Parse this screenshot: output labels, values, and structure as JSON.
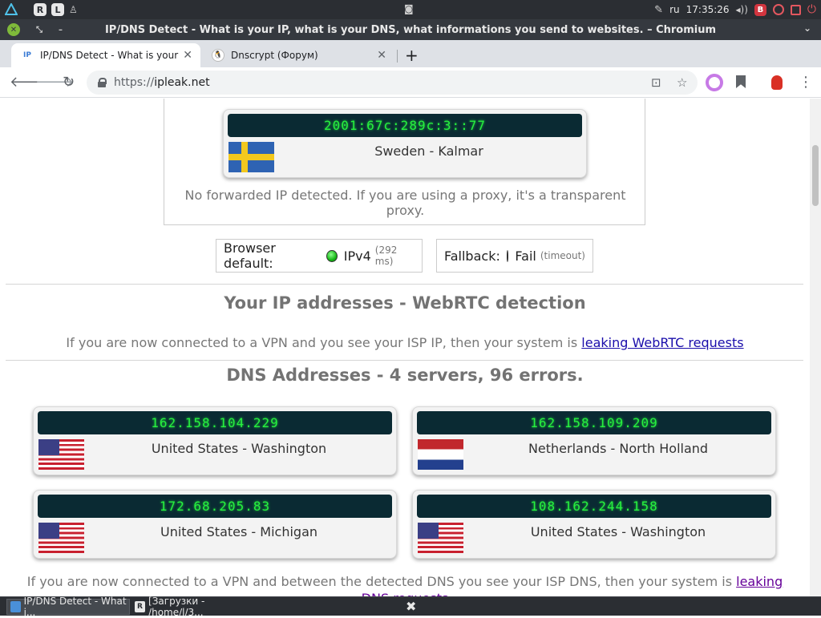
{
  "os_panel": {
    "key_r": "R",
    "key_l": "L",
    "language": "ru",
    "clock": "17:35:26",
    "badge_b": "B"
  },
  "window": {
    "title": "IP/DNS Detect - What is your IP, what is your DNS, what informations you send to websites. – Chromium"
  },
  "tabs": [
    {
      "title": "IP/DNS Detect - What is your IP",
      "favicon": "IP"
    },
    {
      "title": "Dnscrypt (Форум)"
    }
  ],
  "address_bar": {
    "scheme": "https://",
    "host": "ipleak.net"
  },
  "page": {
    "forwarded_card": {
      "ip": "2001:67c:289c:3::77",
      "location": "Sweden - Kalmar"
    },
    "forwarded_note": "No forwarded IP detected. If you are using a proxy, it's a transparent proxy.",
    "browser_default": {
      "label": "Browser default:",
      "value": "IPv4",
      "note": "(292 ms)"
    },
    "fallback": {
      "label": "Fallback:",
      "value": "Fail",
      "note": "(timeout)"
    },
    "webrtc": {
      "title": "Your IP addresses - WebRTC detection",
      "text": "If you are now connected to a VPN and you see your ISP IP, then your system is ",
      "link": "leaking WebRTC requests"
    },
    "dns": {
      "title": "DNS Addresses - 4 servers, 96 errors.",
      "servers": [
        {
          "ip": "162.158.104.229",
          "location": "United States - Washington"
        },
        {
          "ip": "162.158.109.209",
          "location": "Netherlands - North Holland"
        },
        {
          "ip": "172.68.205.83",
          "location": "United States - Michigan"
        },
        {
          "ip": "108.162.244.158",
          "location": "United States - Washington"
        }
      ],
      "text": "If you are now connected to a VPN and between the detected DNS you see your ISP DNS, then your system is ",
      "link": "leaking DNS requests"
    }
  },
  "taskbar": {
    "items": [
      {
        "label": "IP/DNS Detect - What i..."
      },
      {
        "label": "[Загрузки - /home/l/3..."
      }
    ]
  },
  "colors": {
    "ip_text": "#27f03f",
    "ip_bar_bg": "#0a2a33",
    "link": "#1a0dab",
    "visited_link": "#660099"
  }
}
